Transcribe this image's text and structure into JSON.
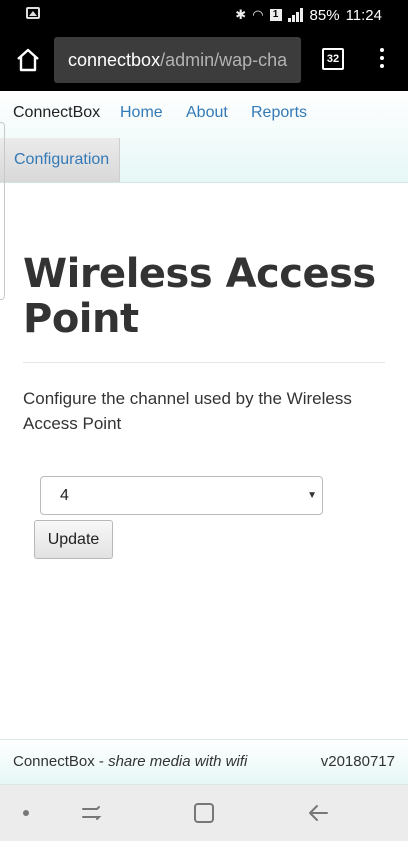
{
  "status_bar": {
    "battery": "85%",
    "time": "11:24",
    "notification_badge": "1"
  },
  "browser": {
    "url_host": "connectbox",
    "url_path": "/admin/wap-cha",
    "tab_count": "32"
  },
  "nav": {
    "brand": "ConnectBox",
    "links": [
      "Home",
      "About",
      "Reports"
    ],
    "active_link": "Configuration"
  },
  "main": {
    "title": "Wireless Access Point",
    "description": "Configure the channel used by the Wireless Access Point",
    "channel_select_value": "4",
    "update_label": "Update"
  },
  "footer": {
    "brand": "ConnectBox",
    "separator": " - ",
    "tagline": "share media with wifi",
    "version": "v20180717"
  },
  "colors": {
    "link": "#337ab7",
    "navbar_gradient_end": "#e6f7f6",
    "toolbar": "#000000"
  }
}
